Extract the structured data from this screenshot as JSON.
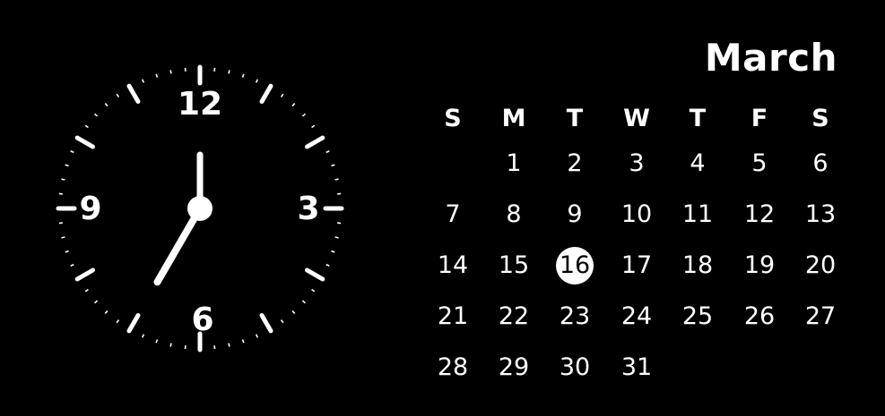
{
  "colors": {
    "background": "#000000",
    "foreground": "#ffffff",
    "today_highlight_bg": "#ffffff",
    "today_highlight_text": "#000000"
  },
  "clock": {
    "numerals": {
      "twelve": "12",
      "three": "3",
      "six": "6",
      "nine": "9"
    },
    "time": {
      "hour": 7,
      "minute": 0
    }
  },
  "calendar": {
    "month": "March",
    "weekdays": [
      "S",
      "M",
      "T",
      "W",
      "T",
      "F",
      "S"
    ],
    "first_weekday_index": 1,
    "days_in_month": 31,
    "today": "16"
  }
}
